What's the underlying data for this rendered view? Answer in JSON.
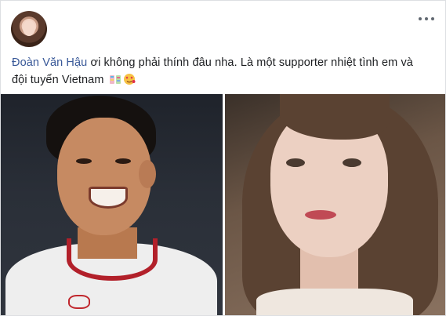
{
  "post": {
    "mention": "Đoàn Văn Hậu",
    "text_line1": " ơi không phải thính đâu nha. Là một supporter nhiệt tình em và",
    "text_line2": "đội tuyển Vietnam",
    "emojis": [
      "confetti-emoji",
      "heart-eyes-emoji"
    ]
  },
  "colors": {
    "mention": "#385898",
    "text": "#1c1e21",
    "divider": "#ffffff"
  }
}
